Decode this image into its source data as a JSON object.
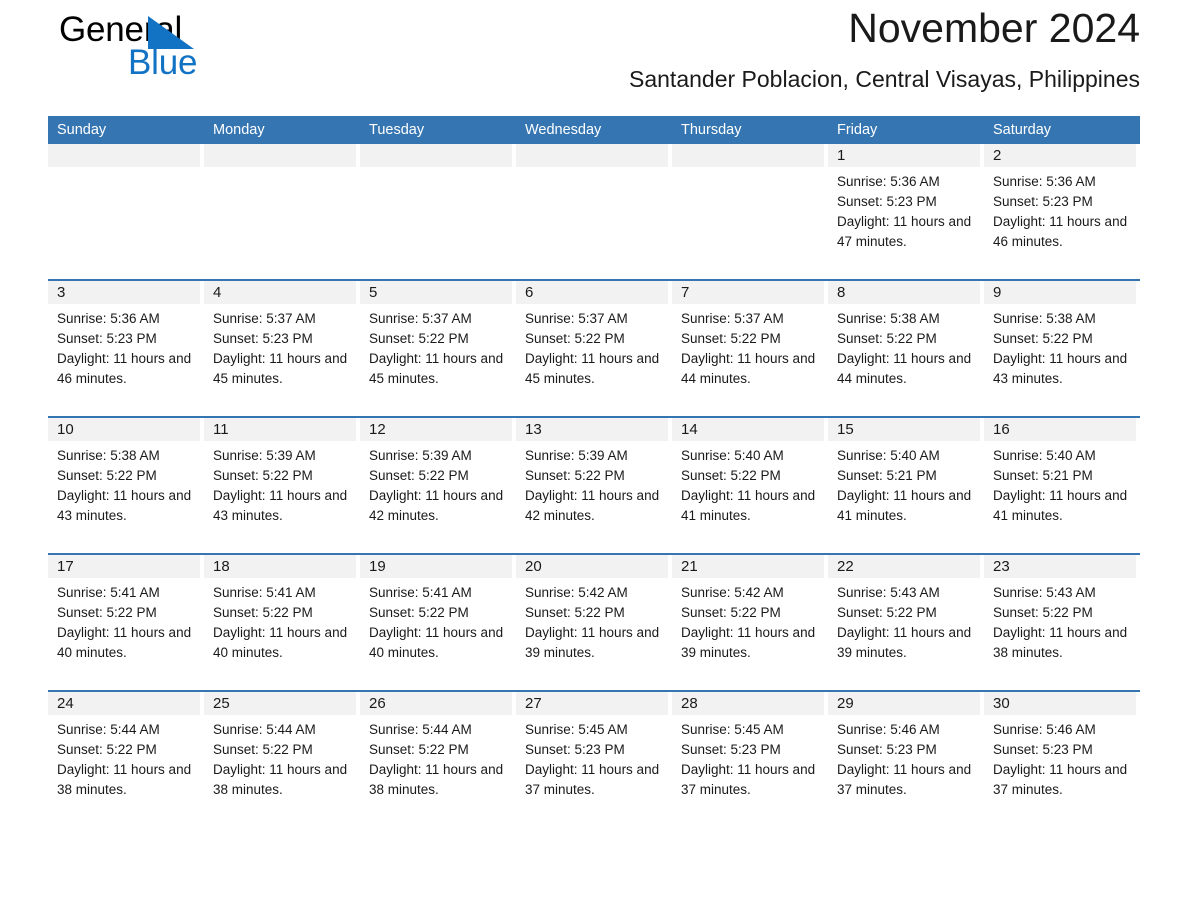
{
  "brand": {
    "name_top": "General",
    "name_bottom": "Blue",
    "triangle_color": "#1273c4"
  },
  "header": {
    "month_title": "November 2024",
    "location": "Santander Poblacion, Central Visayas, Philippines",
    "accent_color": "#3575b2",
    "band_color": "#f2f2f2"
  },
  "calendar": {
    "weekdays": [
      "Sunday",
      "Monday",
      "Tuesday",
      "Wednesday",
      "Thursday",
      "Friday",
      "Saturday"
    ],
    "weeks": [
      [
        {
          "day": "",
          "empty": true
        },
        {
          "day": "",
          "empty": true
        },
        {
          "day": "",
          "empty": true
        },
        {
          "day": "",
          "empty": true
        },
        {
          "day": "",
          "empty": true
        },
        {
          "day": "1",
          "sunrise": "Sunrise: 5:36 AM",
          "sunset": "Sunset: 5:23 PM",
          "daylight": "Daylight: 11 hours and 47 minutes."
        },
        {
          "day": "2",
          "sunrise": "Sunrise: 5:36 AM",
          "sunset": "Sunset: 5:23 PM",
          "daylight": "Daylight: 11 hours and 46 minutes."
        }
      ],
      [
        {
          "day": "3",
          "sunrise": "Sunrise: 5:36 AM",
          "sunset": "Sunset: 5:23 PM",
          "daylight": "Daylight: 11 hours and 46 minutes."
        },
        {
          "day": "4",
          "sunrise": "Sunrise: 5:37 AM",
          "sunset": "Sunset: 5:23 PM",
          "daylight": "Daylight: 11 hours and 45 minutes."
        },
        {
          "day": "5",
          "sunrise": "Sunrise: 5:37 AM",
          "sunset": "Sunset: 5:22 PM",
          "daylight": "Daylight: 11 hours and 45 minutes."
        },
        {
          "day": "6",
          "sunrise": "Sunrise: 5:37 AM",
          "sunset": "Sunset: 5:22 PM",
          "daylight": "Daylight: 11 hours and 45 minutes."
        },
        {
          "day": "7",
          "sunrise": "Sunrise: 5:37 AM",
          "sunset": "Sunset: 5:22 PM",
          "daylight": "Daylight: 11 hours and 44 minutes."
        },
        {
          "day": "8",
          "sunrise": "Sunrise: 5:38 AM",
          "sunset": "Sunset: 5:22 PM",
          "daylight": "Daylight: 11 hours and 44 minutes."
        },
        {
          "day": "9",
          "sunrise": "Sunrise: 5:38 AM",
          "sunset": "Sunset: 5:22 PM",
          "daylight": "Daylight: 11 hours and 43 minutes."
        }
      ],
      [
        {
          "day": "10",
          "sunrise": "Sunrise: 5:38 AM",
          "sunset": "Sunset: 5:22 PM",
          "daylight": "Daylight: 11 hours and 43 minutes."
        },
        {
          "day": "11",
          "sunrise": "Sunrise: 5:39 AM",
          "sunset": "Sunset: 5:22 PM",
          "daylight": "Daylight: 11 hours and 43 minutes."
        },
        {
          "day": "12",
          "sunrise": "Sunrise: 5:39 AM",
          "sunset": "Sunset: 5:22 PM",
          "daylight": "Daylight: 11 hours and 42 minutes."
        },
        {
          "day": "13",
          "sunrise": "Sunrise: 5:39 AM",
          "sunset": "Sunset: 5:22 PM",
          "daylight": "Daylight: 11 hours and 42 minutes."
        },
        {
          "day": "14",
          "sunrise": "Sunrise: 5:40 AM",
          "sunset": "Sunset: 5:22 PM",
          "daylight": "Daylight: 11 hours and 41 minutes."
        },
        {
          "day": "15",
          "sunrise": "Sunrise: 5:40 AM",
          "sunset": "Sunset: 5:21 PM",
          "daylight": "Daylight: 11 hours and 41 minutes."
        },
        {
          "day": "16",
          "sunrise": "Sunrise: 5:40 AM",
          "sunset": "Sunset: 5:21 PM",
          "daylight": "Daylight: 11 hours and 41 minutes."
        }
      ],
      [
        {
          "day": "17",
          "sunrise": "Sunrise: 5:41 AM",
          "sunset": "Sunset: 5:22 PM",
          "daylight": "Daylight: 11 hours and 40 minutes."
        },
        {
          "day": "18",
          "sunrise": "Sunrise: 5:41 AM",
          "sunset": "Sunset: 5:22 PM",
          "daylight": "Daylight: 11 hours and 40 minutes."
        },
        {
          "day": "19",
          "sunrise": "Sunrise: 5:41 AM",
          "sunset": "Sunset: 5:22 PM",
          "daylight": "Daylight: 11 hours and 40 minutes."
        },
        {
          "day": "20",
          "sunrise": "Sunrise: 5:42 AM",
          "sunset": "Sunset: 5:22 PM",
          "daylight": "Daylight: 11 hours and 39 minutes."
        },
        {
          "day": "21",
          "sunrise": "Sunrise: 5:42 AM",
          "sunset": "Sunset: 5:22 PM",
          "daylight": "Daylight: 11 hours and 39 minutes."
        },
        {
          "day": "22",
          "sunrise": "Sunrise: 5:43 AM",
          "sunset": "Sunset: 5:22 PM",
          "daylight": "Daylight: 11 hours and 39 minutes."
        },
        {
          "day": "23",
          "sunrise": "Sunrise: 5:43 AM",
          "sunset": "Sunset: 5:22 PM",
          "daylight": "Daylight: 11 hours and 38 minutes."
        }
      ],
      [
        {
          "day": "24",
          "sunrise": "Sunrise: 5:44 AM",
          "sunset": "Sunset: 5:22 PM",
          "daylight": "Daylight: 11 hours and 38 minutes."
        },
        {
          "day": "25",
          "sunrise": "Sunrise: 5:44 AM",
          "sunset": "Sunset: 5:22 PM",
          "daylight": "Daylight: 11 hours and 38 minutes."
        },
        {
          "day": "26",
          "sunrise": "Sunrise: 5:44 AM",
          "sunset": "Sunset: 5:22 PM",
          "daylight": "Daylight: 11 hours and 38 minutes."
        },
        {
          "day": "27",
          "sunrise": "Sunrise: 5:45 AM",
          "sunset": "Sunset: 5:23 PM",
          "daylight": "Daylight: 11 hours and 37 minutes."
        },
        {
          "day": "28",
          "sunrise": "Sunrise: 5:45 AM",
          "sunset": "Sunset: 5:23 PM",
          "daylight": "Daylight: 11 hours and 37 minutes."
        },
        {
          "day": "29",
          "sunrise": "Sunrise: 5:46 AM",
          "sunset": "Sunset: 5:23 PM",
          "daylight": "Daylight: 11 hours and 37 minutes."
        },
        {
          "day": "30",
          "sunrise": "Sunrise: 5:46 AM",
          "sunset": "Sunset: 5:23 PM",
          "daylight": "Daylight: 11 hours and 37 minutes."
        }
      ]
    ]
  }
}
